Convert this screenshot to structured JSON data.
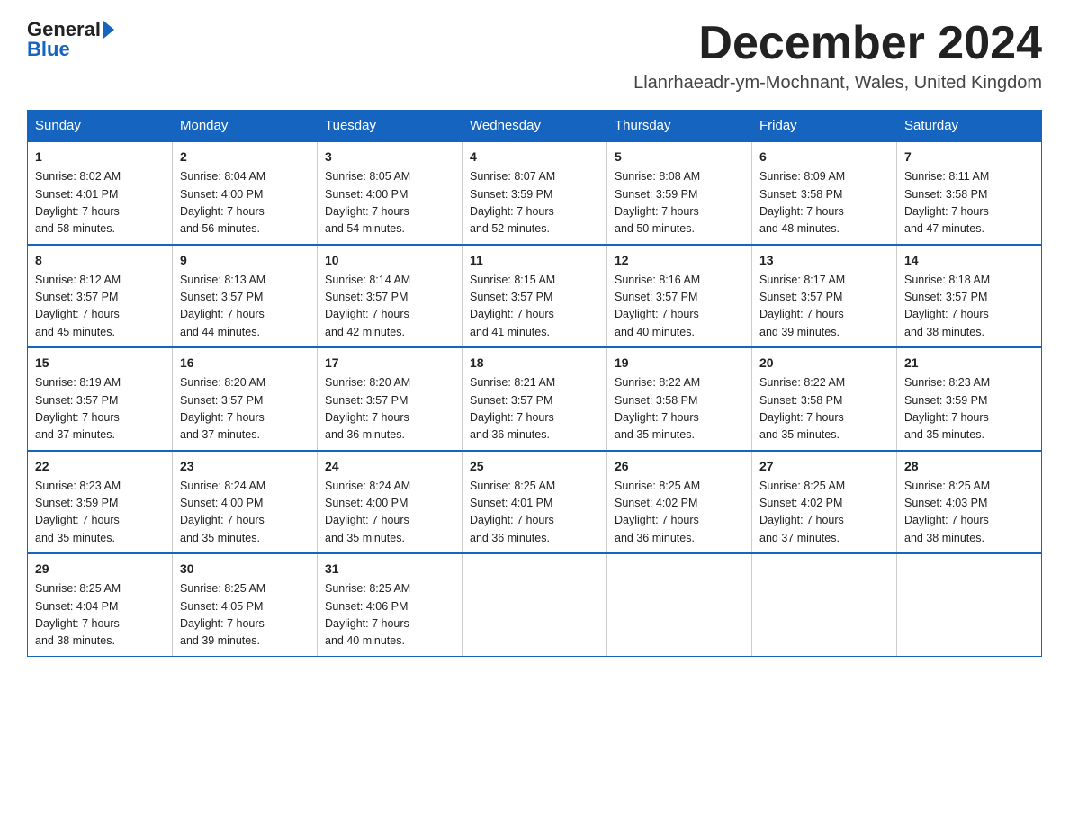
{
  "header": {
    "logo_general": "General",
    "logo_blue": "Blue",
    "title": "December 2024",
    "location": "Llanrhaeadr-ym-Mochnant, Wales, United Kingdom"
  },
  "days_of_week": [
    "Sunday",
    "Monday",
    "Tuesday",
    "Wednesday",
    "Thursday",
    "Friday",
    "Saturday"
  ],
  "weeks": [
    [
      {
        "day": "1",
        "info": "Sunrise: 8:02 AM\nSunset: 4:01 PM\nDaylight: 7 hours\nand 58 minutes."
      },
      {
        "day": "2",
        "info": "Sunrise: 8:04 AM\nSunset: 4:00 PM\nDaylight: 7 hours\nand 56 minutes."
      },
      {
        "day": "3",
        "info": "Sunrise: 8:05 AM\nSunset: 4:00 PM\nDaylight: 7 hours\nand 54 minutes."
      },
      {
        "day": "4",
        "info": "Sunrise: 8:07 AM\nSunset: 3:59 PM\nDaylight: 7 hours\nand 52 minutes."
      },
      {
        "day": "5",
        "info": "Sunrise: 8:08 AM\nSunset: 3:59 PM\nDaylight: 7 hours\nand 50 minutes."
      },
      {
        "day": "6",
        "info": "Sunrise: 8:09 AM\nSunset: 3:58 PM\nDaylight: 7 hours\nand 48 minutes."
      },
      {
        "day": "7",
        "info": "Sunrise: 8:11 AM\nSunset: 3:58 PM\nDaylight: 7 hours\nand 47 minutes."
      }
    ],
    [
      {
        "day": "8",
        "info": "Sunrise: 8:12 AM\nSunset: 3:57 PM\nDaylight: 7 hours\nand 45 minutes."
      },
      {
        "day": "9",
        "info": "Sunrise: 8:13 AM\nSunset: 3:57 PM\nDaylight: 7 hours\nand 44 minutes."
      },
      {
        "day": "10",
        "info": "Sunrise: 8:14 AM\nSunset: 3:57 PM\nDaylight: 7 hours\nand 42 minutes."
      },
      {
        "day": "11",
        "info": "Sunrise: 8:15 AM\nSunset: 3:57 PM\nDaylight: 7 hours\nand 41 minutes."
      },
      {
        "day": "12",
        "info": "Sunrise: 8:16 AM\nSunset: 3:57 PM\nDaylight: 7 hours\nand 40 minutes."
      },
      {
        "day": "13",
        "info": "Sunrise: 8:17 AM\nSunset: 3:57 PM\nDaylight: 7 hours\nand 39 minutes."
      },
      {
        "day": "14",
        "info": "Sunrise: 8:18 AM\nSunset: 3:57 PM\nDaylight: 7 hours\nand 38 minutes."
      }
    ],
    [
      {
        "day": "15",
        "info": "Sunrise: 8:19 AM\nSunset: 3:57 PM\nDaylight: 7 hours\nand 37 minutes."
      },
      {
        "day": "16",
        "info": "Sunrise: 8:20 AM\nSunset: 3:57 PM\nDaylight: 7 hours\nand 37 minutes."
      },
      {
        "day": "17",
        "info": "Sunrise: 8:20 AM\nSunset: 3:57 PM\nDaylight: 7 hours\nand 36 minutes."
      },
      {
        "day": "18",
        "info": "Sunrise: 8:21 AM\nSunset: 3:57 PM\nDaylight: 7 hours\nand 36 minutes."
      },
      {
        "day": "19",
        "info": "Sunrise: 8:22 AM\nSunset: 3:58 PM\nDaylight: 7 hours\nand 35 minutes."
      },
      {
        "day": "20",
        "info": "Sunrise: 8:22 AM\nSunset: 3:58 PM\nDaylight: 7 hours\nand 35 minutes."
      },
      {
        "day": "21",
        "info": "Sunrise: 8:23 AM\nSunset: 3:59 PM\nDaylight: 7 hours\nand 35 minutes."
      }
    ],
    [
      {
        "day": "22",
        "info": "Sunrise: 8:23 AM\nSunset: 3:59 PM\nDaylight: 7 hours\nand 35 minutes."
      },
      {
        "day": "23",
        "info": "Sunrise: 8:24 AM\nSunset: 4:00 PM\nDaylight: 7 hours\nand 35 minutes."
      },
      {
        "day": "24",
        "info": "Sunrise: 8:24 AM\nSunset: 4:00 PM\nDaylight: 7 hours\nand 35 minutes."
      },
      {
        "day": "25",
        "info": "Sunrise: 8:25 AM\nSunset: 4:01 PM\nDaylight: 7 hours\nand 36 minutes."
      },
      {
        "day": "26",
        "info": "Sunrise: 8:25 AM\nSunset: 4:02 PM\nDaylight: 7 hours\nand 36 minutes."
      },
      {
        "day": "27",
        "info": "Sunrise: 8:25 AM\nSunset: 4:02 PM\nDaylight: 7 hours\nand 37 minutes."
      },
      {
        "day": "28",
        "info": "Sunrise: 8:25 AM\nSunset: 4:03 PM\nDaylight: 7 hours\nand 38 minutes."
      }
    ],
    [
      {
        "day": "29",
        "info": "Sunrise: 8:25 AM\nSunset: 4:04 PM\nDaylight: 7 hours\nand 38 minutes."
      },
      {
        "day": "30",
        "info": "Sunrise: 8:25 AM\nSunset: 4:05 PM\nDaylight: 7 hours\nand 39 minutes."
      },
      {
        "day": "31",
        "info": "Sunrise: 8:25 AM\nSunset: 4:06 PM\nDaylight: 7 hours\nand 40 minutes."
      },
      {
        "day": "",
        "info": ""
      },
      {
        "day": "",
        "info": ""
      },
      {
        "day": "",
        "info": ""
      },
      {
        "day": "",
        "info": ""
      }
    ]
  ]
}
